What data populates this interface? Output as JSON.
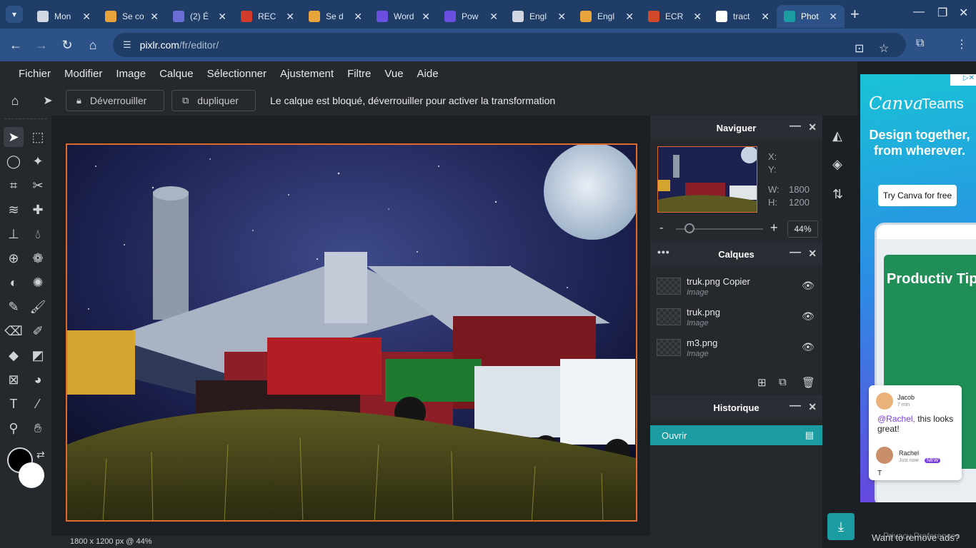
{
  "browser": {
    "tabs": [
      {
        "label": "Mon",
        "color": "#d0d7e0"
      },
      {
        "label": "Se co",
        "color": "#e8a43a"
      },
      {
        "label": "(2) É",
        "color": "#6b6ed6"
      },
      {
        "label": "REC",
        "color": "#d23a2a"
      },
      {
        "label": "Se d",
        "color": "#e8a43a"
      },
      {
        "label": "Word",
        "color": "#6a4fe0"
      },
      {
        "label": "Pow",
        "color": "#6a4fe0"
      },
      {
        "label": "Engl",
        "color": "#d0d7e0"
      },
      {
        "label": "Engl",
        "color": "#e8a43a"
      },
      {
        "label": "ECR",
        "color": "#d24a2a"
      },
      {
        "label": "tract",
        "color": "#ffffff"
      },
      {
        "label": "Phot",
        "color": "#1b9ca0",
        "active": true
      }
    ],
    "url_host": "pixlr.com",
    "url_path": "/fr/editor/"
  },
  "menu": [
    "Fichier",
    "Modifier",
    "Image",
    "Calque",
    "Sélectionner",
    "Ajustement",
    "Filtre",
    "Vue",
    "Aide"
  ],
  "options": {
    "unlock_label": "Déverrouiller",
    "duplicate_label": "dupliquer",
    "message": "Le calque est bloqué, déverrouiller pour activer la transformation"
  },
  "navigator": {
    "title": "Naviguer",
    "x_label": "X:",
    "y_label": "Y:",
    "w_label": "W:",
    "w_value": "1800",
    "h_label": "H:",
    "h_value": "1200",
    "zoom": "44%",
    "zoom_minus": "-",
    "zoom_plus": "+"
  },
  "layers": {
    "title": "Calques",
    "items": [
      {
        "name": "truk.png Copier",
        "type": "Image"
      },
      {
        "name": "truk.png",
        "type": "Image"
      },
      {
        "name": "m3.png",
        "type": "Image"
      }
    ]
  },
  "history": {
    "title": "Historique",
    "items": [
      "Ouvrir"
    ]
  },
  "status": "1800 x 1200 px @ 44%",
  "ad": {
    "brand": "Canva",
    "brand2": "Teams",
    "headline": "Design together, from wherever.",
    "cta": "Try Canva for free",
    "phone_title": "Productiv Tips",
    "chat": {
      "name1": "Jacob",
      "time1": "7 min",
      "message_mention": "@Rachel,",
      "message_rest": " this looks great!",
      "name2": "Rachel",
      "time2": "Just now",
      "badge": "NEW",
      "typing": "T"
    },
    "footer": "Want to remove ads?",
    "footer_overlay": "Privacy Preferences"
  },
  "colors": {
    "accent": "#1b9ca0",
    "canvas_border": "#e06a2a",
    "foreground": "#000000",
    "background": "#ffffff"
  }
}
